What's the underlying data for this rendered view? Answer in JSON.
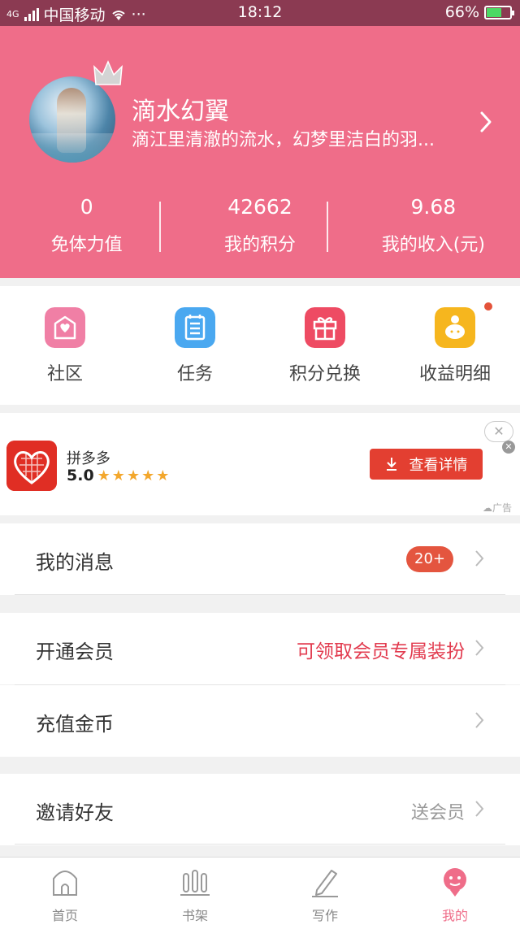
{
  "status_bar": {
    "network": "4G",
    "carrier": "中国移动",
    "more": "···",
    "time": "18:12",
    "battery": "66%",
    "battery_level": 0.66
  },
  "profile": {
    "name": "滴水幻翼",
    "bio": "滴江里清澈的流水，幻梦里洁白的羽..."
  },
  "stats": [
    {
      "value": "0",
      "label": "免体力值"
    },
    {
      "value": "42662",
      "label": "我的积分"
    },
    {
      "value": "9.68",
      "label": "我的收入(元)"
    }
  ],
  "quick_menu": [
    {
      "label": "社区",
      "icon": "heart-envelope-icon",
      "color": "#f07fa5"
    },
    {
      "label": "任务",
      "icon": "checklist-icon",
      "color": "#4aa8f0"
    },
    {
      "label": "积分兑换",
      "icon": "gift-icon",
      "color": "#ee4b63"
    },
    {
      "label": "收益明细",
      "icon": "piggy-bank-icon",
      "color": "#f6b61e"
    }
  ],
  "ad": {
    "app_name": "拼多多",
    "rating": "5.0",
    "stars": "★★★★★",
    "button_label": "查看详情",
    "close_symbol": "✕",
    "tag": "广告"
  },
  "rows": {
    "messages": {
      "label": "我的消息",
      "badge": "20+"
    },
    "vip": {
      "label": "开通会员",
      "value": "可领取会员专属装扮"
    },
    "recharge": {
      "label": "充值金币"
    },
    "invite": {
      "label": "邀请好友",
      "value": "送会员"
    }
  },
  "tabs": [
    {
      "label": "首页",
      "icon": "home-icon"
    },
    {
      "label": "书架",
      "icon": "bookshelf-icon"
    },
    {
      "label": "写作",
      "icon": "pen-icon"
    },
    {
      "label": "我的",
      "icon": "profile-icon",
      "active": true
    }
  ],
  "colors": {
    "header_bg": "#ef6d89",
    "status_bar_bg": "#8b3a52",
    "accent_red": "#e23b4f",
    "badge_red": "#e4553f"
  }
}
